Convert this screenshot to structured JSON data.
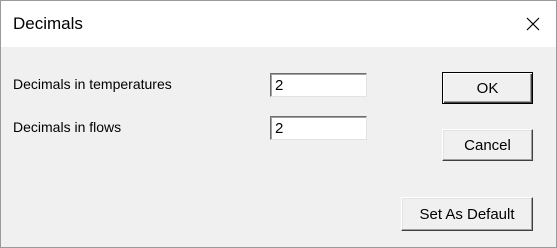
{
  "window": {
    "title": "Decimals",
    "close_glyph": "✕"
  },
  "fields": [
    {
      "label": "Decimals in temperatures",
      "value": "2"
    },
    {
      "label": "Decimals in flows",
      "value": "2"
    }
  ],
  "buttons": {
    "ok": "OK",
    "cancel": "Cancel",
    "set_default": "Set As Default"
  }
}
